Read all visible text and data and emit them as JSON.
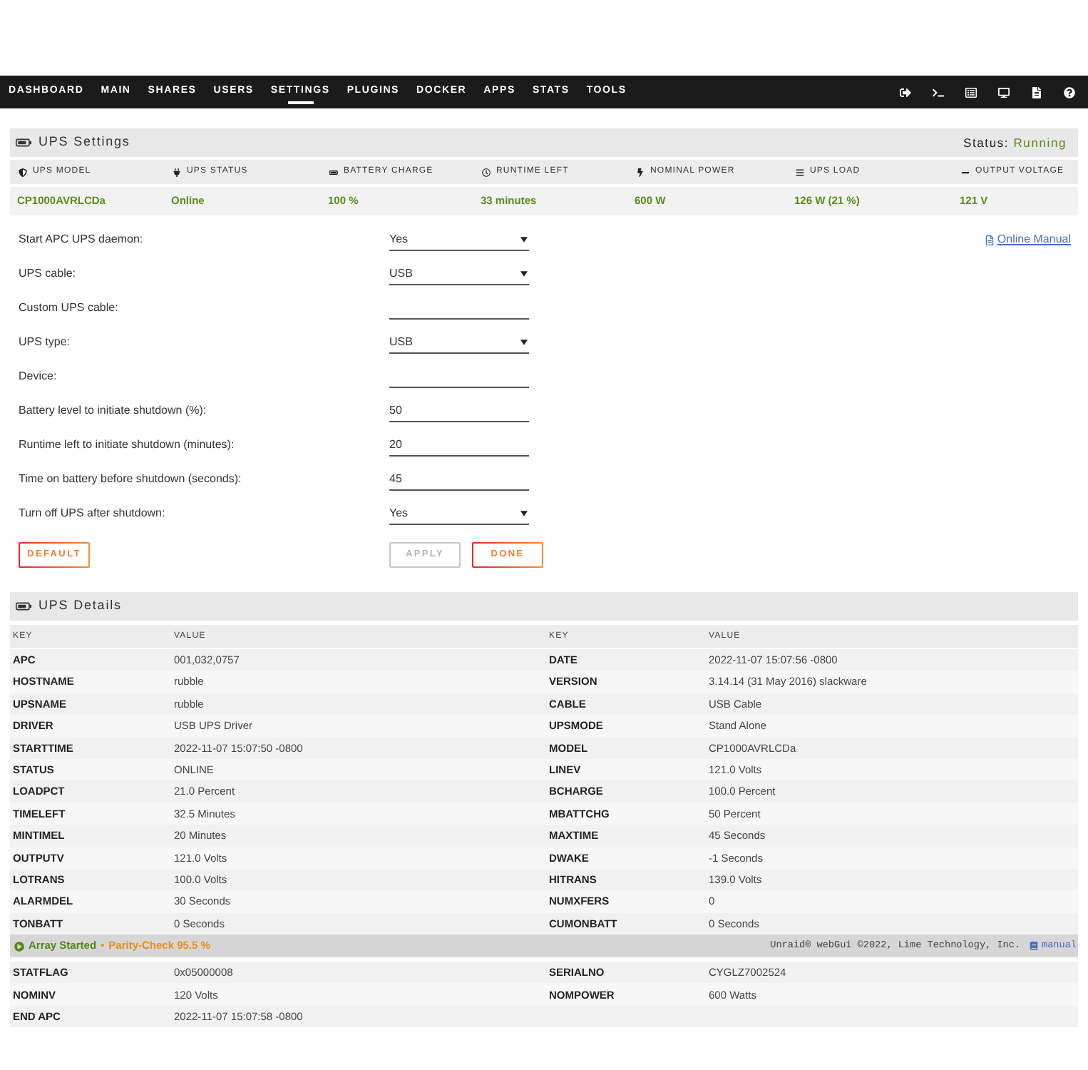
{
  "nav": {
    "tabs": [
      {
        "label": "DASHBOARD",
        "selected": false
      },
      {
        "label": "MAIN",
        "selected": false
      },
      {
        "label": "SHARES",
        "selected": false
      },
      {
        "label": "USERS",
        "selected": false
      },
      {
        "label": "SETTINGS",
        "selected": true
      },
      {
        "label": "PLUGINS",
        "selected": false
      },
      {
        "label": "DOCKER",
        "selected": false
      },
      {
        "label": "APPS",
        "selected": false
      },
      {
        "label": "STATS",
        "selected": false
      },
      {
        "label": "TOOLS",
        "selected": false
      }
    ]
  },
  "settings": {
    "title": "UPS Settings",
    "status_label": "Status:",
    "status_value": "Running",
    "summary": [
      {
        "label": "UPS MODEL",
        "value": "CP1000AVRLCDa"
      },
      {
        "label": "UPS STATUS",
        "value": "Online"
      },
      {
        "label": "BATTERY CHARGE",
        "value": "100 %"
      },
      {
        "label": "RUNTIME LEFT",
        "value": "33 minutes"
      },
      {
        "label": "NOMINAL POWER",
        "value": "600 W"
      },
      {
        "label": "UPS LOAD",
        "value": "126 W (21 %)"
      },
      {
        "label": "OUTPUT VOLTAGE",
        "value": "121 V"
      }
    ]
  },
  "form": {
    "manual_link": "Online Manual",
    "fields": [
      {
        "kind": "select",
        "label": "Start APC UPS daemon:",
        "value": "Yes"
      },
      {
        "kind": "select",
        "label": "UPS cable:",
        "value": "USB"
      },
      {
        "kind": "text",
        "label": "Custom UPS cable:"
      },
      {
        "kind": "select",
        "label": "UPS type:",
        "value": "USB"
      },
      {
        "kind": "text",
        "label": "Device:"
      },
      {
        "kind": "text",
        "label": "Battery level to initiate shutdown (%):",
        "value": "50"
      },
      {
        "kind": "text",
        "label": "Runtime left to initiate shutdown (minutes):",
        "value": "20"
      },
      {
        "kind": "text",
        "label": "Time on battery before shutdown (seconds):",
        "value": "45"
      },
      {
        "kind": "select",
        "label": "Turn off UPS after shutdown:",
        "value": "Yes"
      }
    ],
    "default_button": {
      "label": "DEFAULT",
      "disabled": false
    },
    "action_buttons": [
      {
        "label": "APPLY",
        "disabled": true
      },
      {
        "label": "DONE",
        "disabled": false
      }
    ]
  },
  "details": {
    "title": "UPS Details",
    "columns": [
      "KEY",
      "VALUE",
      "KEY",
      "VALUE"
    ],
    "rows": [
      [
        "APC",
        "001,032,0757",
        "DATE",
        "2022-11-07 15:07:56 -0800"
      ],
      [
        "HOSTNAME",
        "rubble",
        "VERSION",
        "3.14.14 (31 May 2016) slackware"
      ],
      [
        "UPSNAME",
        "rubble",
        "CABLE",
        "USB Cable"
      ],
      [
        "DRIVER",
        "USB UPS Driver",
        "UPSMODE",
        "Stand Alone"
      ],
      [
        "STARTTIME",
        "2022-11-07 15:07:50 -0800",
        "MODEL",
        "CP1000AVRLCDa"
      ],
      [
        "STATUS",
        "ONLINE",
        "LINEV",
        "121.0 Volts"
      ],
      [
        "LOADPCT",
        "21.0 Percent",
        "BCHARGE",
        "100.0 Percent"
      ],
      [
        "TIMELEFT",
        "32.5 Minutes",
        "MBATTCHG",
        "50 Percent"
      ],
      [
        "MINTIMEL",
        "20 Minutes",
        "MAXTIME",
        "45 Seconds"
      ],
      [
        "OUTPUTV",
        "121.0 Volts",
        "DWAKE",
        "-1 Seconds"
      ],
      [
        "LOTRANS",
        "100.0 Volts",
        "HITRANS",
        "139.0 Volts"
      ],
      [
        "ALARMDEL",
        "30 Seconds",
        "NUMXFERS",
        "0"
      ],
      [
        "TONBATT",
        "0 Seconds",
        "CUMONBATT",
        "0 Seconds"
      ]
    ]
  },
  "status_bar": {
    "array_status": "Array Started",
    "separator": "•",
    "parity_status": "Parity-Check 95.5 %",
    "copyright": "Unraid® webGui ©2022, Lime Technology, Inc.",
    "manual_link": "manual"
  },
  "details_continued": {
    "rows": [
      [
        "STATFLAG",
        "0x05000008",
        "SERIALNO",
        "CYGLZ7002524"
      ],
      [
        "NOMINV",
        "120 Volts",
        "NOMPOWER",
        "600 Watts"
      ],
      [
        "END APC",
        "2022-11-07 15:07:58 -0800"
      ]
    ]
  }
}
